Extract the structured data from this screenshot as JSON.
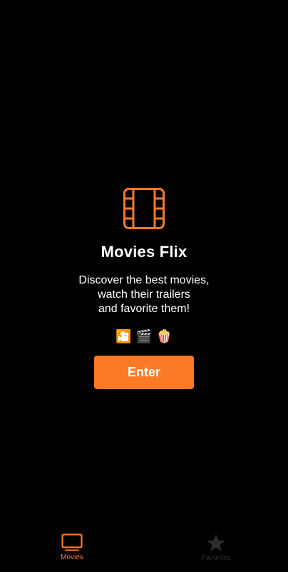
{
  "app": {
    "title": "Movies Flix",
    "description_lines": [
      "Discover the best movies,",
      "watch their trailers",
      "and favorite them!"
    ],
    "emojis": [
      "🎦",
      "🎬",
      "🍿"
    ],
    "enter_label": "Enter",
    "logo_icon": "film-strip-icon"
  },
  "tabbar": {
    "tabs": [
      {
        "label": "Movies",
        "icon": "tv-icon",
        "active": true
      },
      {
        "label": "Favorites",
        "icon": "star-icon",
        "active": false
      }
    ]
  },
  "colors": {
    "background": "#000000",
    "accent": "#fa7a28",
    "text": "#ffffff",
    "inactive_tab": "#2e2e2e"
  }
}
